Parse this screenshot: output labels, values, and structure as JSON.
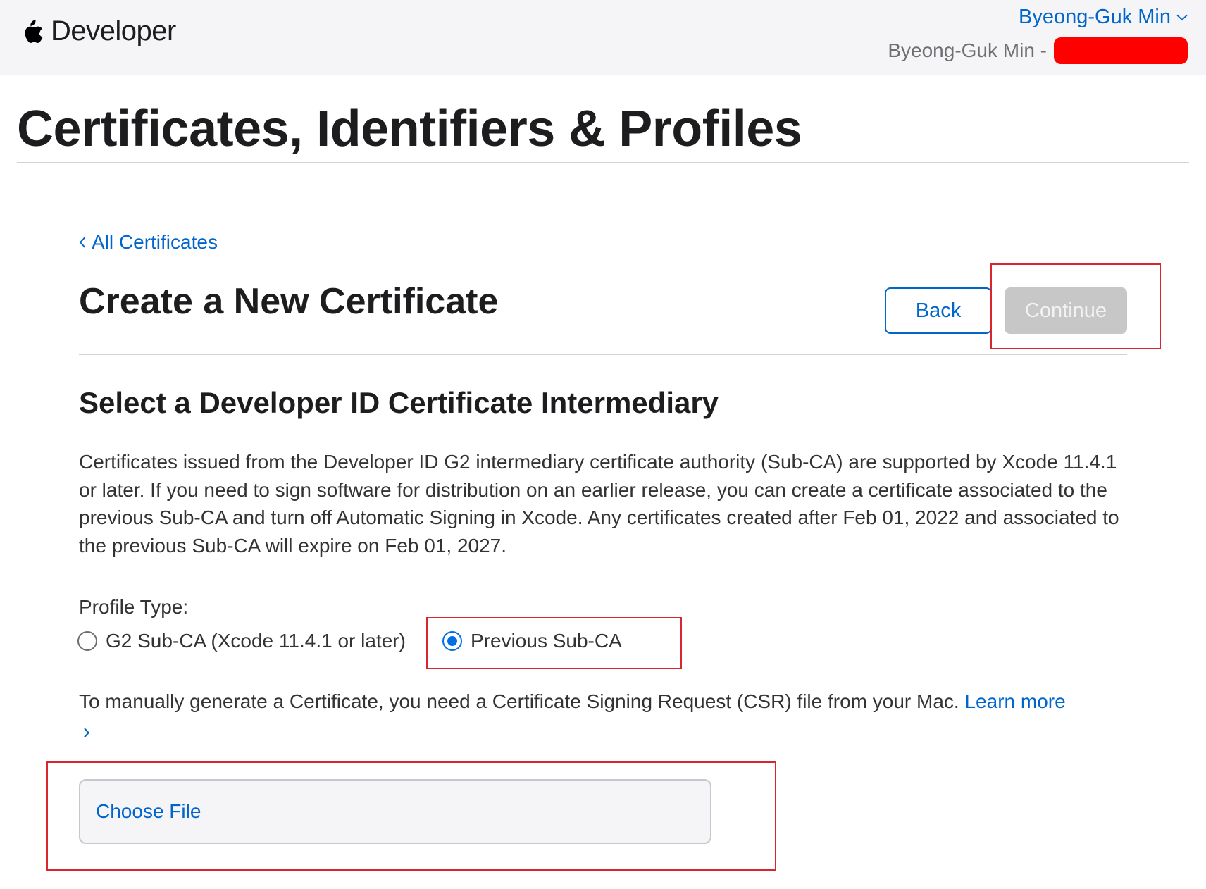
{
  "header": {
    "brand": "Developer",
    "user_name": "Byeong-Guk Min",
    "team_prefix": "Byeong-Guk Min -"
  },
  "page": {
    "title": "Certificates, Identifiers & Profiles"
  },
  "nav": {
    "back_link": "All Certificates"
  },
  "section": {
    "title": "Create a New Certificate",
    "back_button": "Back",
    "continue_button": "Continue"
  },
  "intermediary": {
    "heading": "Select a Developer ID Certificate Intermediary",
    "description": "Certificates issued from the Developer ID G2 intermediary certificate authority (Sub-CA) are supported by Xcode 11.4.1 or later. If you need to sign software for distribution on an earlier release, you can create a certificate associated to the previous Sub-CA and turn off Automatic Signing in Xcode. Any certificates created after Feb 01, 2022 and associated to the previous Sub-CA will expire on Feb 01, 2027.",
    "profile_type_label": "Profile Type:",
    "options": [
      {
        "label": "G2 Sub-CA (Xcode 11.4.1 or later)",
        "selected": false
      },
      {
        "label": "Previous Sub-CA",
        "selected": true
      }
    ]
  },
  "csr": {
    "text": "To manually generate a Certificate, you need a Certificate Signing Request (CSR) file from your Mac.",
    "learn_more": "Learn more",
    "learn_more_chevron": "›",
    "choose_file": "Choose File"
  },
  "colors": {
    "link": "#0066cc",
    "annotation": "#d7262e",
    "redaction": "#ff0000",
    "disabled_button": "#c7c7c7"
  }
}
